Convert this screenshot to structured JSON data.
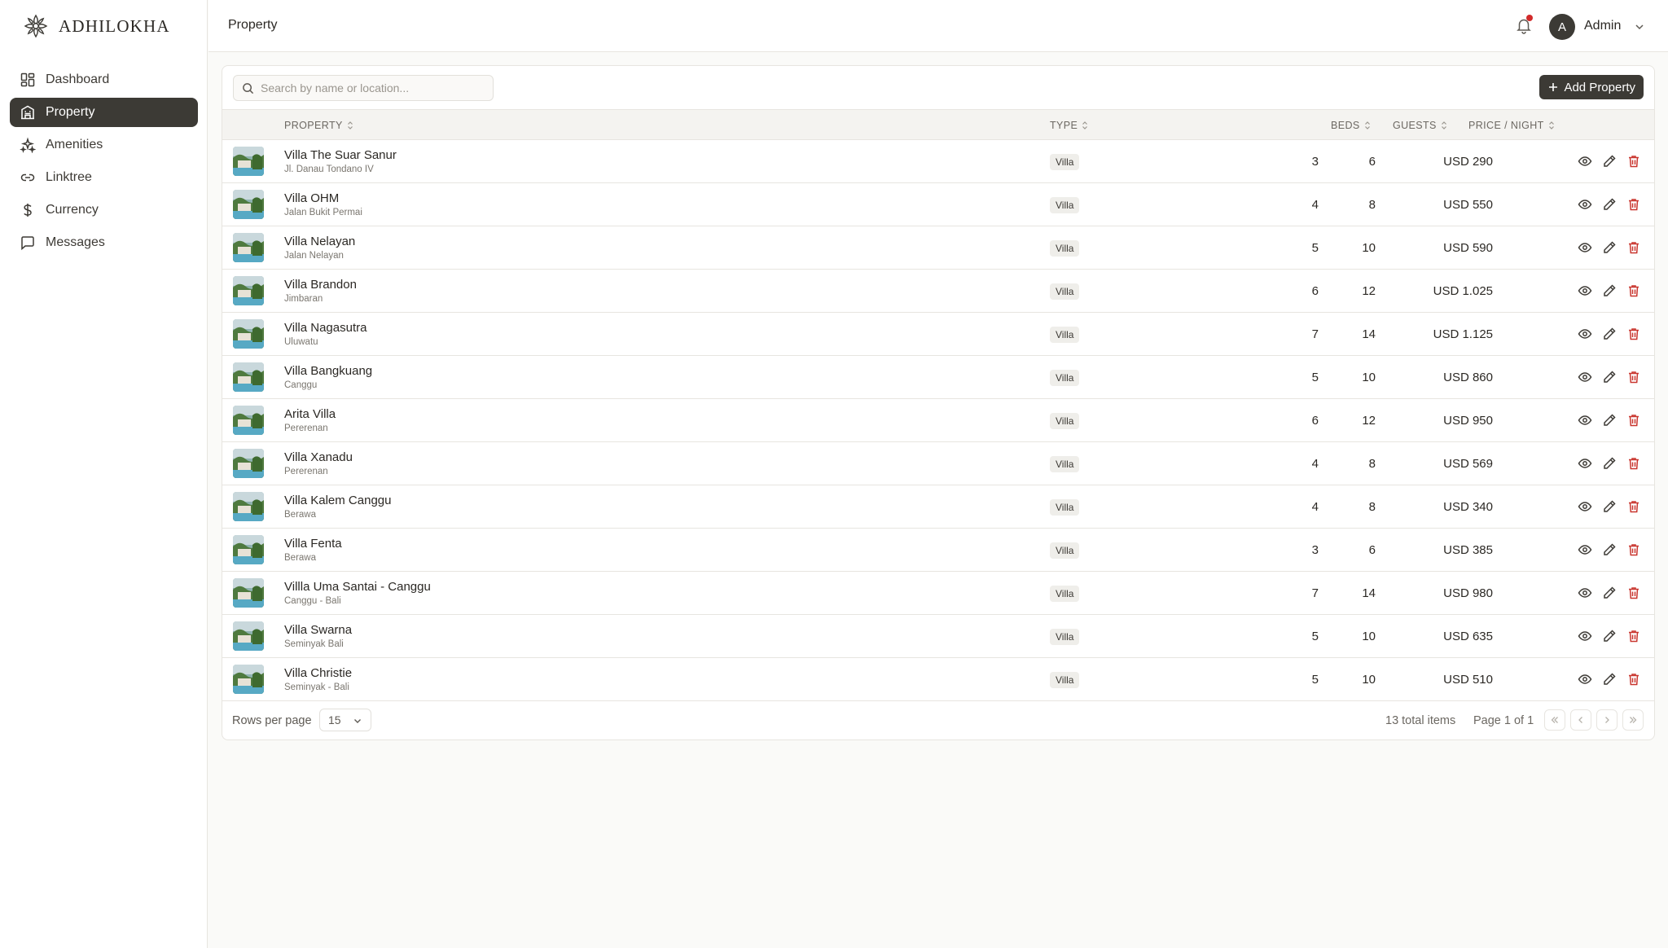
{
  "brand": {
    "name": "ADHILOKHA",
    "logo_icon": "lotus-logo-icon"
  },
  "sidebar": {
    "items": [
      {
        "label": "Dashboard",
        "icon": "dashboard-icon",
        "active": false
      },
      {
        "label": "Property",
        "icon": "building-icon",
        "active": true
      },
      {
        "label": "Amenities",
        "icon": "sparkles-icon",
        "active": false
      },
      {
        "label": "Linktree",
        "icon": "link-icon",
        "active": false
      },
      {
        "label": "Currency",
        "icon": "dollar-icon",
        "active": false
      },
      {
        "label": "Messages",
        "icon": "message-icon",
        "active": false
      }
    ]
  },
  "header": {
    "breadcrumb": "Property",
    "user_initial": "A",
    "user_name": "Admin",
    "notification_dot_color": "#d22a2a"
  },
  "toolbar": {
    "search_placeholder": "Search by name or location...",
    "add_label": "Add Property"
  },
  "table": {
    "columns": {
      "property": "PROPERTY",
      "type": "TYPE",
      "beds": "BEDS",
      "guests": "GUESTS",
      "price": "PRICE / NIGHT"
    },
    "rows": [
      {
        "name": "Villa The Suar Sanur",
        "location": "Jl. Danau Tondano IV",
        "type": "Villa",
        "beds": "3",
        "guests": "6",
        "price": "USD 290"
      },
      {
        "name": "Villa OHM",
        "location": "Jalan Bukit Permai",
        "type": "Villa",
        "beds": "4",
        "guests": "8",
        "price": "USD 550"
      },
      {
        "name": "Villa Nelayan",
        "location": "Jalan Nelayan",
        "type": "Villa",
        "beds": "5",
        "guests": "10",
        "price": "USD 590"
      },
      {
        "name": "Villa Brandon",
        "location": "Jimbaran",
        "type": "Villa",
        "beds": "6",
        "guests": "12",
        "price": "USD 1.025"
      },
      {
        "name": "Villa Nagasutra",
        "location": "Uluwatu",
        "type": "Villa",
        "beds": "7",
        "guests": "14",
        "price": "USD 1.125"
      },
      {
        "name": "Villa Bangkuang",
        "location": "Canggu",
        "type": "Villa",
        "beds": "5",
        "guests": "10",
        "price": "USD 860"
      },
      {
        "name": "Arita Villa",
        "location": "Pererenan",
        "type": "Villa",
        "beds": "6",
        "guests": "12",
        "price": "USD 950"
      },
      {
        "name": "Villa Xanadu",
        "location": "Pererenan",
        "type": "Villa",
        "beds": "4",
        "guests": "8",
        "price": "USD 569"
      },
      {
        "name": "Villa Kalem Canggu",
        "location": "Berawa",
        "type": "Villa",
        "beds": "4",
        "guests": "8",
        "price": "USD 340"
      },
      {
        "name": "Villa Fenta",
        "location": "Berawa",
        "type": "Villa",
        "beds": "3",
        "guests": "6",
        "price": "USD 385"
      },
      {
        "name": "Villla Uma Santai - Canggu",
        "location": "Canggu - Bali",
        "type": "Villa",
        "beds": "7",
        "guests": "14",
        "price": "USD 980"
      },
      {
        "name": "Villa Swarna",
        "location": "Seminyak Bali",
        "type": "Villa",
        "beds": "5",
        "guests": "10",
        "price": "USD 635"
      },
      {
        "name": "Villa Christie",
        "location": "Seminyak - Bali",
        "type": "Villa",
        "beds": "5",
        "guests": "10",
        "price": "USD 510"
      }
    ]
  },
  "pagination": {
    "rows_per_page_label": "Rows per page",
    "rows_per_page": "15",
    "total_items": "13 total items",
    "page_info": "Page 1 of 1"
  },
  "colors": {
    "accent": "#3c3a35",
    "delete": "#c9362f",
    "border": "#e7e5e0"
  }
}
